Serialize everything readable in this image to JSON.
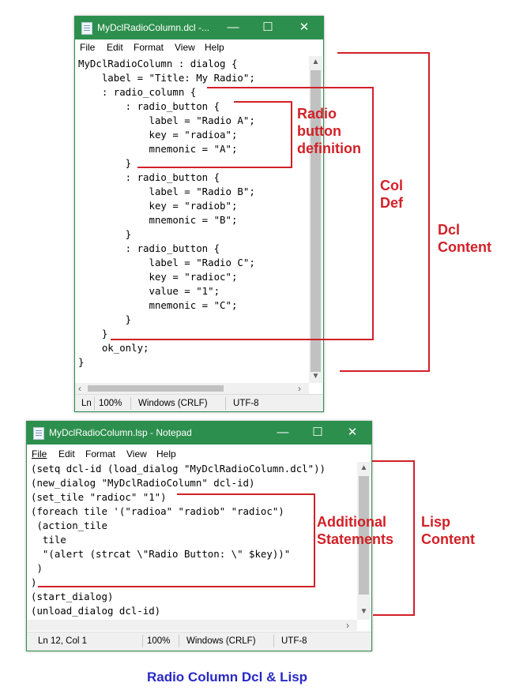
{
  "dcl_window": {
    "title": "MyDclRadioColumn.dcl -...",
    "controls": {
      "minimize": "—",
      "maximize": "☐",
      "close": "✕"
    },
    "menu": [
      "File",
      "Edit",
      "Format",
      "View",
      "Help"
    ],
    "code": "MyDclRadioColumn : dialog {\n    label = \"Title: My Radio\";\n    : radio_column {\n        : radio_button {\n            label = \"Radio A\";\n            key = \"radioa\";\n            mnemonic = \"A\";\n        }\n        : radio_button {\n            label = \"Radio B\";\n            key = \"radiob\";\n            mnemonic = \"B\";\n        }\n        : radio_button {\n            label = \"Radio C\";\n            key = \"radioc\";\n            value = \"1\";\n            mnemonic = \"C\";\n        }\n    }\n    ok_only;\n}",
    "status": {
      "position": "Ln",
      "zoom": "100%",
      "line_ending": "Windows (CRLF)",
      "encoding": "UTF-8"
    }
  },
  "lsp_window": {
    "title": "MyDclRadioColumn.lsp - Notepad",
    "controls": {
      "minimize": "—",
      "maximize": "☐",
      "close": "✕"
    },
    "menu": [
      "File",
      "Edit",
      "Format",
      "View",
      "Help"
    ],
    "code": "(setq dcl-id (load_dialog \"MyDclRadioColumn.dcl\"))\n(new_dialog \"MyDclRadioColumn\" dcl-id)\n(set_tile \"radioc\" \"1\")\n(foreach tile '(\"radioa\" \"radiob\" \"radioc\")\n (action_tile\n  tile\n  \"(alert (strcat \\\"Radio Button: \\\" $key))\"\n )\n)\n(start_dialog)\n(unload_dialog dcl-id)",
    "status": {
      "position": "Ln 12, Col 1",
      "zoom": "100%",
      "line_ending": "Windows (CRLF)",
      "encoding": "UTF-8"
    }
  },
  "annotations": {
    "radio_def": "Radio\nbutton\ndefinition",
    "col_def": "Col\nDef",
    "dcl_content": "Dcl\nContent",
    "additional": "Additional\nStatements",
    "lisp_content": "Lisp\nContent"
  },
  "caption": "Radio Column Dcl & Lisp",
  "colors": {
    "titlebar": "#2d8f4d",
    "annotation": "#d32027",
    "caption": "#2828c8"
  }
}
